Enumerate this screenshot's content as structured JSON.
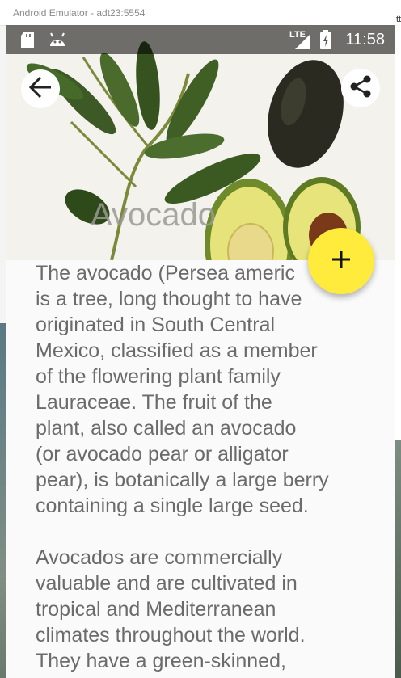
{
  "window": {
    "title": "Android Emulator - adt23:5554"
  },
  "status_bar": {
    "time": "11:58",
    "network": "LTE",
    "icons": [
      "sd-card-icon",
      "android-debug-icon",
      "lte-signal-icon",
      "battery-charging-icon"
    ]
  },
  "toolbar": {
    "back_icon": "arrow-back-icon",
    "share_icon": "share-icon"
  },
  "hero": {
    "title": "Avocado"
  },
  "fab": {
    "icon": "plus-icon",
    "color": "#ffeb3b"
  },
  "article": {
    "paragraphs": [
      "The avocado (Persea americ\nis a tree, long thought to have\noriginated in South Central\nMexico, classified as a member\nof the flowering plant family\nLauraceae. The fruit of the\nplant, also called an avocado\n(or avocado pear or alligator\npear), is botanically a large berry\ncontaining a single large seed.",
      "Avocados are commercially\nvaluable and are cultivated in\ntropical and Mediterranean\nclimates throughout the world.\nThey have a green-skinned,"
    ]
  },
  "background": {
    "partial_text": "tt"
  }
}
